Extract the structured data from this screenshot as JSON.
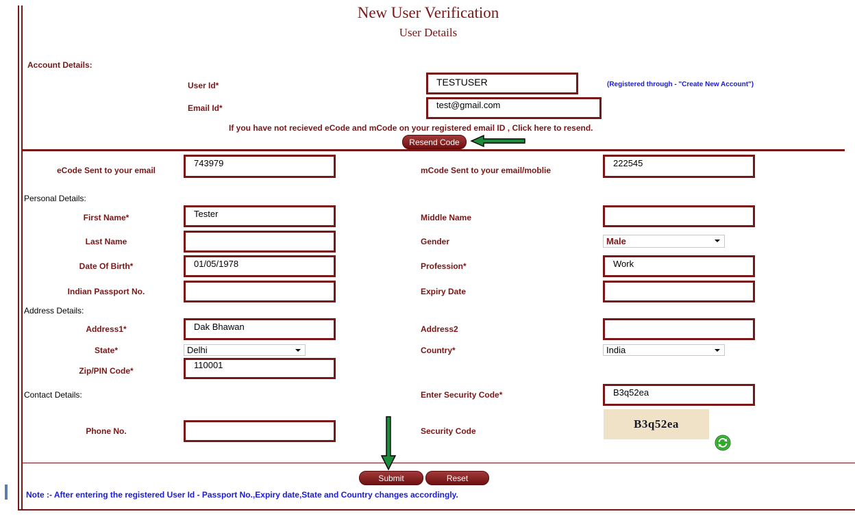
{
  "header": {
    "title": "New User Verification",
    "subtitle": "User Details"
  },
  "account": {
    "section_label": "Account Details:",
    "user_id_label": "User Id*",
    "user_id_value": "TESTUSER",
    "registered_note": "(Registered through - \"Create New Account\")",
    "email_label": "Email Id*",
    "email_value": "test@gmail.com",
    "resend_message": "If you have not recieved eCode and mCode on your registered email ID , Click here to resend.",
    "resend_button": "Resend Code"
  },
  "codes": {
    "ecode_label": "eCode Sent to your email",
    "ecode_value": "743979",
    "mcode_label": "mCode Sent to your email/moblie",
    "mcode_value": "222545"
  },
  "personal": {
    "section_label": "Personal Details:",
    "first_name_label": "First Name*",
    "first_name_value": "Tester",
    "middle_name_label": "Middle Name",
    "middle_name_value": "",
    "last_name_label": "Last Name",
    "last_name_value": "",
    "gender_label": "Gender",
    "gender_value": "Male",
    "dob_label": "Date Of Birth*",
    "dob_value": "01/05/1978",
    "profession_label": "Profession*",
    "profession_value": "Work",
    "passport_label": "Indian Passport No.",
    "passport_value": "",
    "expiry_label": "Expiry Date",
    "expiry_value": ""
  },
  "address": {
    "section_label": "Address Details:",
    "address1_label": "Address1*",
    "address1_value": "Dak Bhawan",
    "address2_label": "Address2",
    "address2_value": "",
    "state_label": "State*",
    "state_value": "Delhi",
    "country_label": "Country*",
    "country_value": "India",
    "zip_label": "Zip/PIN Code*",
    "zip_value": "110001"
  },
  "contact": {
    "section_label": "Contact Details:",
    "security_code_input_label": "Enter Security Code*",
    "security_code_input_value": "B3q52ea",
    "phone_label": "Phone No.",
    "phone_value": "",
    "security_code_label": "Security Code",
    "captcha_text": "B3q52ea"
  },
  "actions": {
    "submit": "Submit",
    "reset": "Reset"
  },
  "note": "Note :- After entering the registered User Id - Passport No.,Expiry date,State and Country changes accordingly.",
  "colors": {
    "accent": "#7a1616",
    "note_blue": "#1a1adb",
    "arrow_green": "#1e8a3c"
  }
}
